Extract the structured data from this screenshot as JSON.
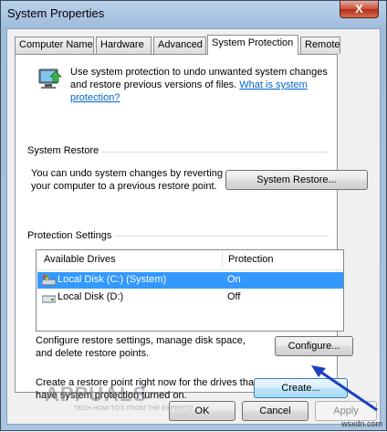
{
  "window": {
    "title": "System Properties",
    "close_glyph": "X"
  },
  "tabs": [
    {
      "label": "Computer Name",
      "active": false
    },
    {
      "label": "Hardware",
      "active": false
    },
    {
      "label": "Advanced",
      "active": false
    },
    {
      "label": "System Protection",
      "active": true
    },
    {
      "label": "Remote",
      "active": false
    }
  ],
  "intro": {
    "text": "Use system protection to undo unwanted system changes and restore previous versions of files.",
    "link": "What is system protection?"
  },
  "system_restore": {
    "group_title": "System Restore",
    "description": "You can undo system changes by reverting your computer to a previous restore point.",
    "button": "System Restore..."
  },
  "protection": {
    "group_title": "Protection Settings",
    "columns": [
      "Available Drives",
      "Protection"
    ],
    "drives": [
      {
        "name": "Local Disk (C:) (System)",
        "protection": "On",
        "selected": true,
        "icon": "system-drive-icon"
      },
      {
        "name": "Local Disk (D:)",
        "protection": "Off",
        "selected": false,
        "icon": "drive-icon"
      }
    ],
    "configure_text": "Configure restore settings, manage disk space, and delete restore points.",
    "configure_button": "Configure...",
    "create_text": "Create a restore point right now for the drives that have system protection turned on.",
    "create_button": "Create..."
  },
  "footer": {
    "ok": "OK",
    "cancel": "Cancel",
    "apply": "Apply"
  },
  "watermark": {
    "brand": "APPUALS",
    "tagline": "TECH HOW-TO'S FROM THE EXPERTS!"
  },
  "credit": "wsxdn.com",
  "colors": {
    "accent_selection": "#3399ff",
    "link": "#0066cc",
    "arrow": "#1a3fbf"
  }
}
